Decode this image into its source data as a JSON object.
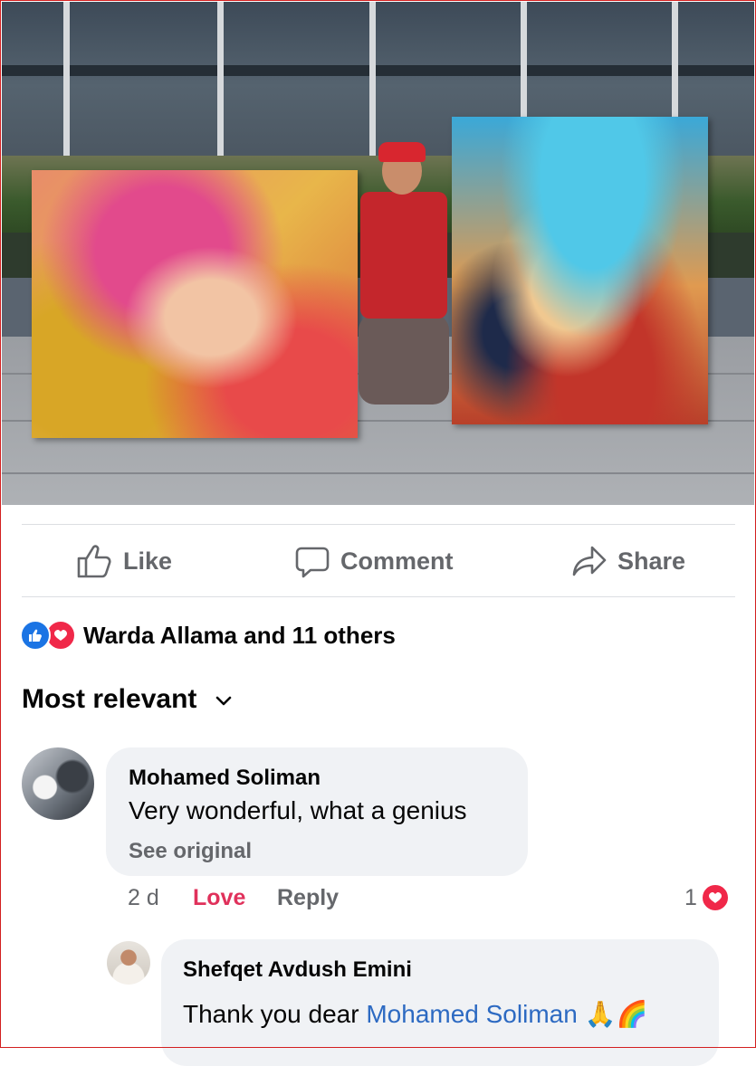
{
  "post": {
    "photo_description_icon": "photo-of-artist-with-two-paintings"
  },
  "actions": {
    "like_label": "Like",
    "comment_label": "Comment",
    "share_label": "Share"
  },
  "reactions": {
    "summary": "Warda Allama and 11 others",
    "icons": [
      "like-reaction-icon",
      "love-reaction-icon"
    ]
  },
  "sort": {
    "label": "Most relevant",
    "icon": "chevron-down-icon"
  },
  "comments": [
    {
      "author": "Mohamed Soliman",
      "text": "Very wonderful, what a genius",
      "see_original": "See original",
      "time": "2 d",
      "love_label": "Love",
      "reply_label": "Reply",
      "reaction_count": "1"
    }
  ],
  "reply": {
    "author": "Shefqet Avdush Emini",
    "text_prefix": "Thank you dear ",
    "mention": "Mohamed Soliman",
    "emoji": "🙏🌈"
  },
  "colors": {
    "love": "#e0315b",
    "mention": "#2d6ac2",
    "like_blue": "#1b74e4",
    "heart_red": "#f02849"
  }
}
